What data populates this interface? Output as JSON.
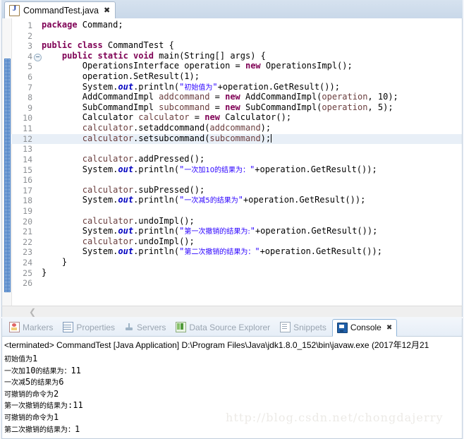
{
  "editor": {
    "tab": {
      "label": "CommandTest.java",
      "icon": "java-file-icon",
      "close": "✖"
    },
    "gutter": {
      "fold_marker_line": 4
    },
    "current_line": 12,
    "lines": [
      {
        "n": "1",
        "segments": [
          {
            "t": "kw",
            "v": "package"
          },
          {
            "t": "p",
            "v": " Command;"
          }
        ]
      },
      {
        "n": "2",
        "segments": []
      },
      {
        "n": "3",
        "segments": [
          {
            "t": "kw",
            "v": "public class"
          },
          {
            "t": "p",
            "v": " CommandTest {"
          }
        ]
      },
      {
        "n": "4",
        "fold": true,
        "segments": [
          {
            "t": "p",
            "v": "    "
          },
          {
            "t": "kw",
            "v": "public static void"
          },
          {
            "t": "p",
            "v": " main(String[] args) {"
          }
        ]
      },
      {
        "n": "5",
        "segments": [
          {
            "t": "p",
            "v": "        OperationsInterface operation = "
          },
          {
            "t": "kw",
            "v": "new"
          },
          {
            "t": "p",
            "v": " OperationsImpl();"
          }
        ]
      },
      {
        "n": "6",
        "segments": [
          {
            "t": "p",
            "v": "        operation.SetResult(1);"
          }
        ]
      },
      {
        "n": "7",
        "segments": [
          {
            "t": "p",
            "v": "        System."
          },
          {
            "t": "fld",
            "v": "out"
          },
          {
            "t": "p",
            "v": ".println("
          },
          {
            "t": "str",
            "v": "\""
          },
          {
            "t": "cn",
            "v": "初始值为"
          },
          {
            "t": "str",
            "v": "\""
          },
          {
            "t": "p",
            "v": "+operation.GetResult());"
          }
        ]
      },
      {
        "n": "8",
        "segments": [
          {
            "t": "p",
            "v": "        AddCommandImpl "
          },
          {
            "t": "loc",
            "v": "addcommand"
          },
          {
            "t": "p",
            "v": " = "
          },
          {
            "t": "kw",
            "v": "new"
          },
          {
            "t": "p",
            "v": " AddCommandImpl("
          },
          {
            "t": "loc",
            "v": "operation"
          },
          {
            "t": "p",
            "v": ", 10);"
          }
        ]
      },
      {
        "n": "9",
        "segments": [
          {
            "t": "p",
            "v": "        SubCommandImpl "
          },
          {
            "t": "loc",
            "v": "subcommand"
          },
          {
            "t": "p",
            "v": " = "
          },
          {
            "t": "kw",
            "v": "new"
          },
          {
            "t": "p",
            "v": " SubCommandImpl("
          },
          {
            "t": "loc",
            "v": "operation"
          },
          {
            "t": "p",
            "v": ", 5);"
          }
        ]
      },
      {
        "n": "10",
        "segments": [
          {
            "t": "p",
            "v": "        Calculator "
          },
          {
            "t": "loc",
            "v": "calculator"
          },
          {
            "t": "p",
            "v": " = "
          },
          {
            "t": "kw",
            "v": "new"
          },
          {
            "t": "p",
            "v": " Calculator();"
          }
        ]
      },
      {
        "n": "11",
        "segments": [
          {
            "t": "p",
            "v": "        "
          },
          {
            "t": "loc",
            "v": "calculator"
          },
          {
            "t": "p",
            "v": ".setaddcommand("
          },
          {
            "t": "loc",
            "v": "addcommand"
          },
          {
            "t": "p",
            "v": ");"
          }
        ]
      },
      {
        "n": "12",
        "current": true,
        "caret": true,
        "segments": [
          {
            "t": "p",
            "v": "        "
          },
          {
            "t": "loc",
            "v": "calculator"
          },
          {
            "t": "p",
            "v": ".setsubcommand("
          },
          {
            "t": "loc",
            "v": "subcommand"
          },
          {
            "t": "p",
            "v": ");"
          }
        ]
      },
      {
        "n": "13",
        "segments": []
      },
      {
        "n": "14",
        "segments": [
          {
            "t": "p",
            "v": "        "
          },
          {
            "t": "loc",
            "v": "calculator"
          },
          {
            "t": "p",
            "v": ".addPressed();"
          }
        ]
      },
      {
        "n": "15",
        "segments": [
          {
            "t": "p",
            "v": "        System."
          },
          {
            "t": "fld",
            "v": "out"
          },
          {
            "t": "p",
            "v": ".println("
          },
          {
            "t": "str",
            "v": "\""
          },
          {
            "t": "cn",
            "v": "一次加10的结果为："
          },
          {
            "t": "str",
            "v": "\""
          },
          {
            "t": "p",
            "v": "+operation.GetResult());"
          }
        ]
      },
      {
        "n": "16",
        "segments": []
      },
      {
        "n": "17",
        "segments": [
          {
            "t": "p",
            "v": "        "
          },
          {
            "t": "loc",
            "v": "calculator"
          },
          {
            "t": "p",
            "v": ".subPressed();"
          }
        ]
      },
      {
        "n": "18",
        "segments": [
          {
            "t": "p",
            "v": "        System."
          },
          {
            "t": "fld",
            "v": "out"
          },
          {
            "t": "p",
            "v": ".println("
          },
          {
            "t": "str",
            "v": "\""
          },
          {
            "t": "cn",
            "v": "一次减5的结果为"
          },
          {
            "t": "str",
            "v": "\""
          },
          {
            "t": "p",
            "v": "+operation.GetResult());"
          }
        ]
      },
      {
        "n": "19",
        "segments": []
      },
      {
        "n": "20",
        "segments": [
          {
            "t": "p",
            "v": "        "
          },
          {
            "t": "loc",
            "v": "calculator"
          },
          {
            "t": "p",
            "v": ".undoImpl();"
          }
        ]
      },
      {
        "n": "21",
        "segments": [
          {
            "t": "p",
            "v": "        System."
          },
          {
            "t": "fld",
            "v": "out"
          },
          {
            "t": "p",
            "v": ".println("
          },
          {
            "t": "str",
            "v": "\""
          },
          {
            "t": "cn",
            "v": "第一次撤销的结果为:"
          },
          {
            "t": "str",
            "v": "\""
          },
          {
            "t": "p",
            "v": "+operation.GetResult());"
          }
        ]
      },
      {
        "n": "22",
        "segments": [
          {
            "t": "p",
            "v": "        "
          },
          {
            "t": "loc",
            "v": "calculator"
          },
          {
            "t": "p",
            "v": ".undoImpl();"
          }
        ]
      },
      {
        "n": "23",
        "segments": [
          {
            "t": "p",
            "v": "        System."
          },
          {
            "t": "fld",
            "v": "out"
          },
          {
            "t": "p",
            "v": ".println("
          },
          {
            "t": "str",
            "v": "\""
          },
          {
            "t": "cn",
            "v": "第二次撤销的结果为："
          },
          {
            "t": "str",
            "v": "\""
          },
          {
            "t": "p",
            "v": "+operation.GetResult());"
          }
        ]
      },
      {
        "n": "24",
        "segments": [
          {
            "t": "p",
            "v": "    }"
          }
        ]
      },
      {
        "n": "25",
        "segments": [
          {
            "t": "p",
            "v": "}"
          }
        ]
      },
      {
        "n": "26",
        "segments": []
      }
    ],
    "hscroll_arrow": "❮"
  },
  "console_panel": {
    "tabs": [
      {
        "label": "Markers",
        "icon": "markers-icon",
        "active": false
      },
      {
        "label": "Properties",
        "icon": "properties-icon",
        "active": false
      },
      {
        "label": "Servers",
        "icon": "servers-icon",
        "active": false
      },
      {
        "label": "Data Source Explorer",
        "icon": "database-icon",
        "active": false
      },
      {
        "label": "Snippets",
        "icon": "snippets-icon",
        "active": false
      },
      {
        "label": "Console",
        "icon": "console-icon",
        "active": true,
        "close": "✖"
      }
    ],
    "status": "<terminated> CommandTest [Java Application] D:\\Program Files\\Java\\jdk1.8.0_152\\bin\\javaw.exe (2017年12月21",
    "output": [
      "初始值为1",
      "一次加10的结果为：11",
      "一次减5的结果为6",
      "可撤销的命令为2",
      "第一次撤销的结果为:11",
      "可撤销的命令为1",
      "第二次撤销的结果为：1"
    ]
  },
  "watermark": "http://blog.csdn.net/chongdajerry",
  "colors": {
    "keyword": "#7F0055",
    "string": "#2A00FF",
    "field": "#0000C0",
    "local_var": "#6A3E3E",
    "current_line": "#E8EFF7",
    "tab_strip": "#CFDCEC"
  }
}
